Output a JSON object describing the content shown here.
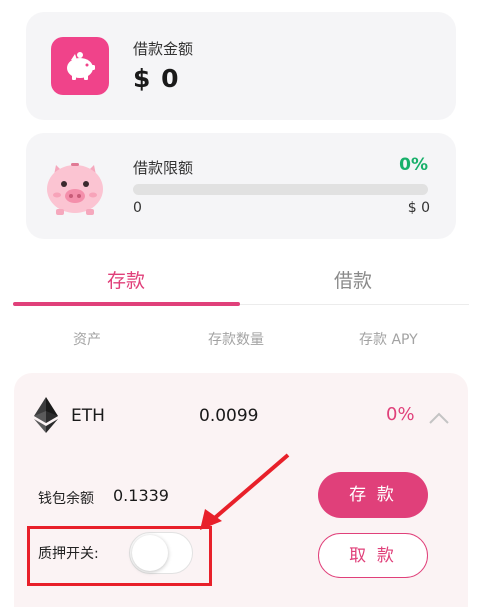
{
  "borrow_card": {
    "label": "借款金额",
    "amount": "$ 0",
    "icon": "piggy-bank-icon"
  },
  "limit_card": {
    "label": "借款限额",
    "percent": "0%",
    "progress_fraction": 0,
    "min": "0",
    "max": "$ 0",
    "icon": "pig-icon"
  },
  "tabs": [
    {
      "label": "存款",
      "active": true
    },
    {
      "label": "借款",
      "active": false
    }
  ],
  "columns": {
    "asset": "资产",
    "quantity": "存款数量",
    "apy": "存款 APY"
  },
  "asset_row": {
    "name": "ETH",
    "amount": "0.0099",
    "apy": "0%",
    "icon": "ethereum-icon",
    "expanded": true
  },
  "details": {
    "wallet_label": "钱包余额",
    "wallet_value": "0.1339",
    "pledge_label": "质押开关:",
    "pledge_on": false,
    "deposit_button": "存 款",
    "withdraw_button": "取 款"
  },
  "colors": {
    "accent": "#e0407a",
    "success": "#18b06a",
    "annotation": "#e8202a"
  }
}
